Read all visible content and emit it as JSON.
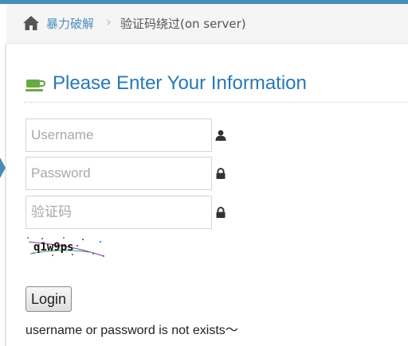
{
  "breadcrumb": {
    "home_icon": "home-icon",
    "parent_label": "暴力破解",
    "separator": "›",
    "current_label": "验证码绕过(on server)"
  },
  "header": {
    "icon": "coffee-cup-icon",
    "title": "Please Enter Your Information"
  },
  "form": {
    "username_placeholder": "Username",
    "username_icon": "user-icon",
    "password_placeholder": "Password",
    "password_icon": "lock-icon",
    "captcha_placeholder": "验证码",
    "captcha_icon": "lock-icon",
    "captcha_image_text": "q1w9ps",
    "login_label": "Login"
  },
  "message": "username or password is not exists～",
  "colors": {
    "accent": "#438eb9",
    "title": "#2679b5",
    "cup_icon": "#69aa46"
  }
}
